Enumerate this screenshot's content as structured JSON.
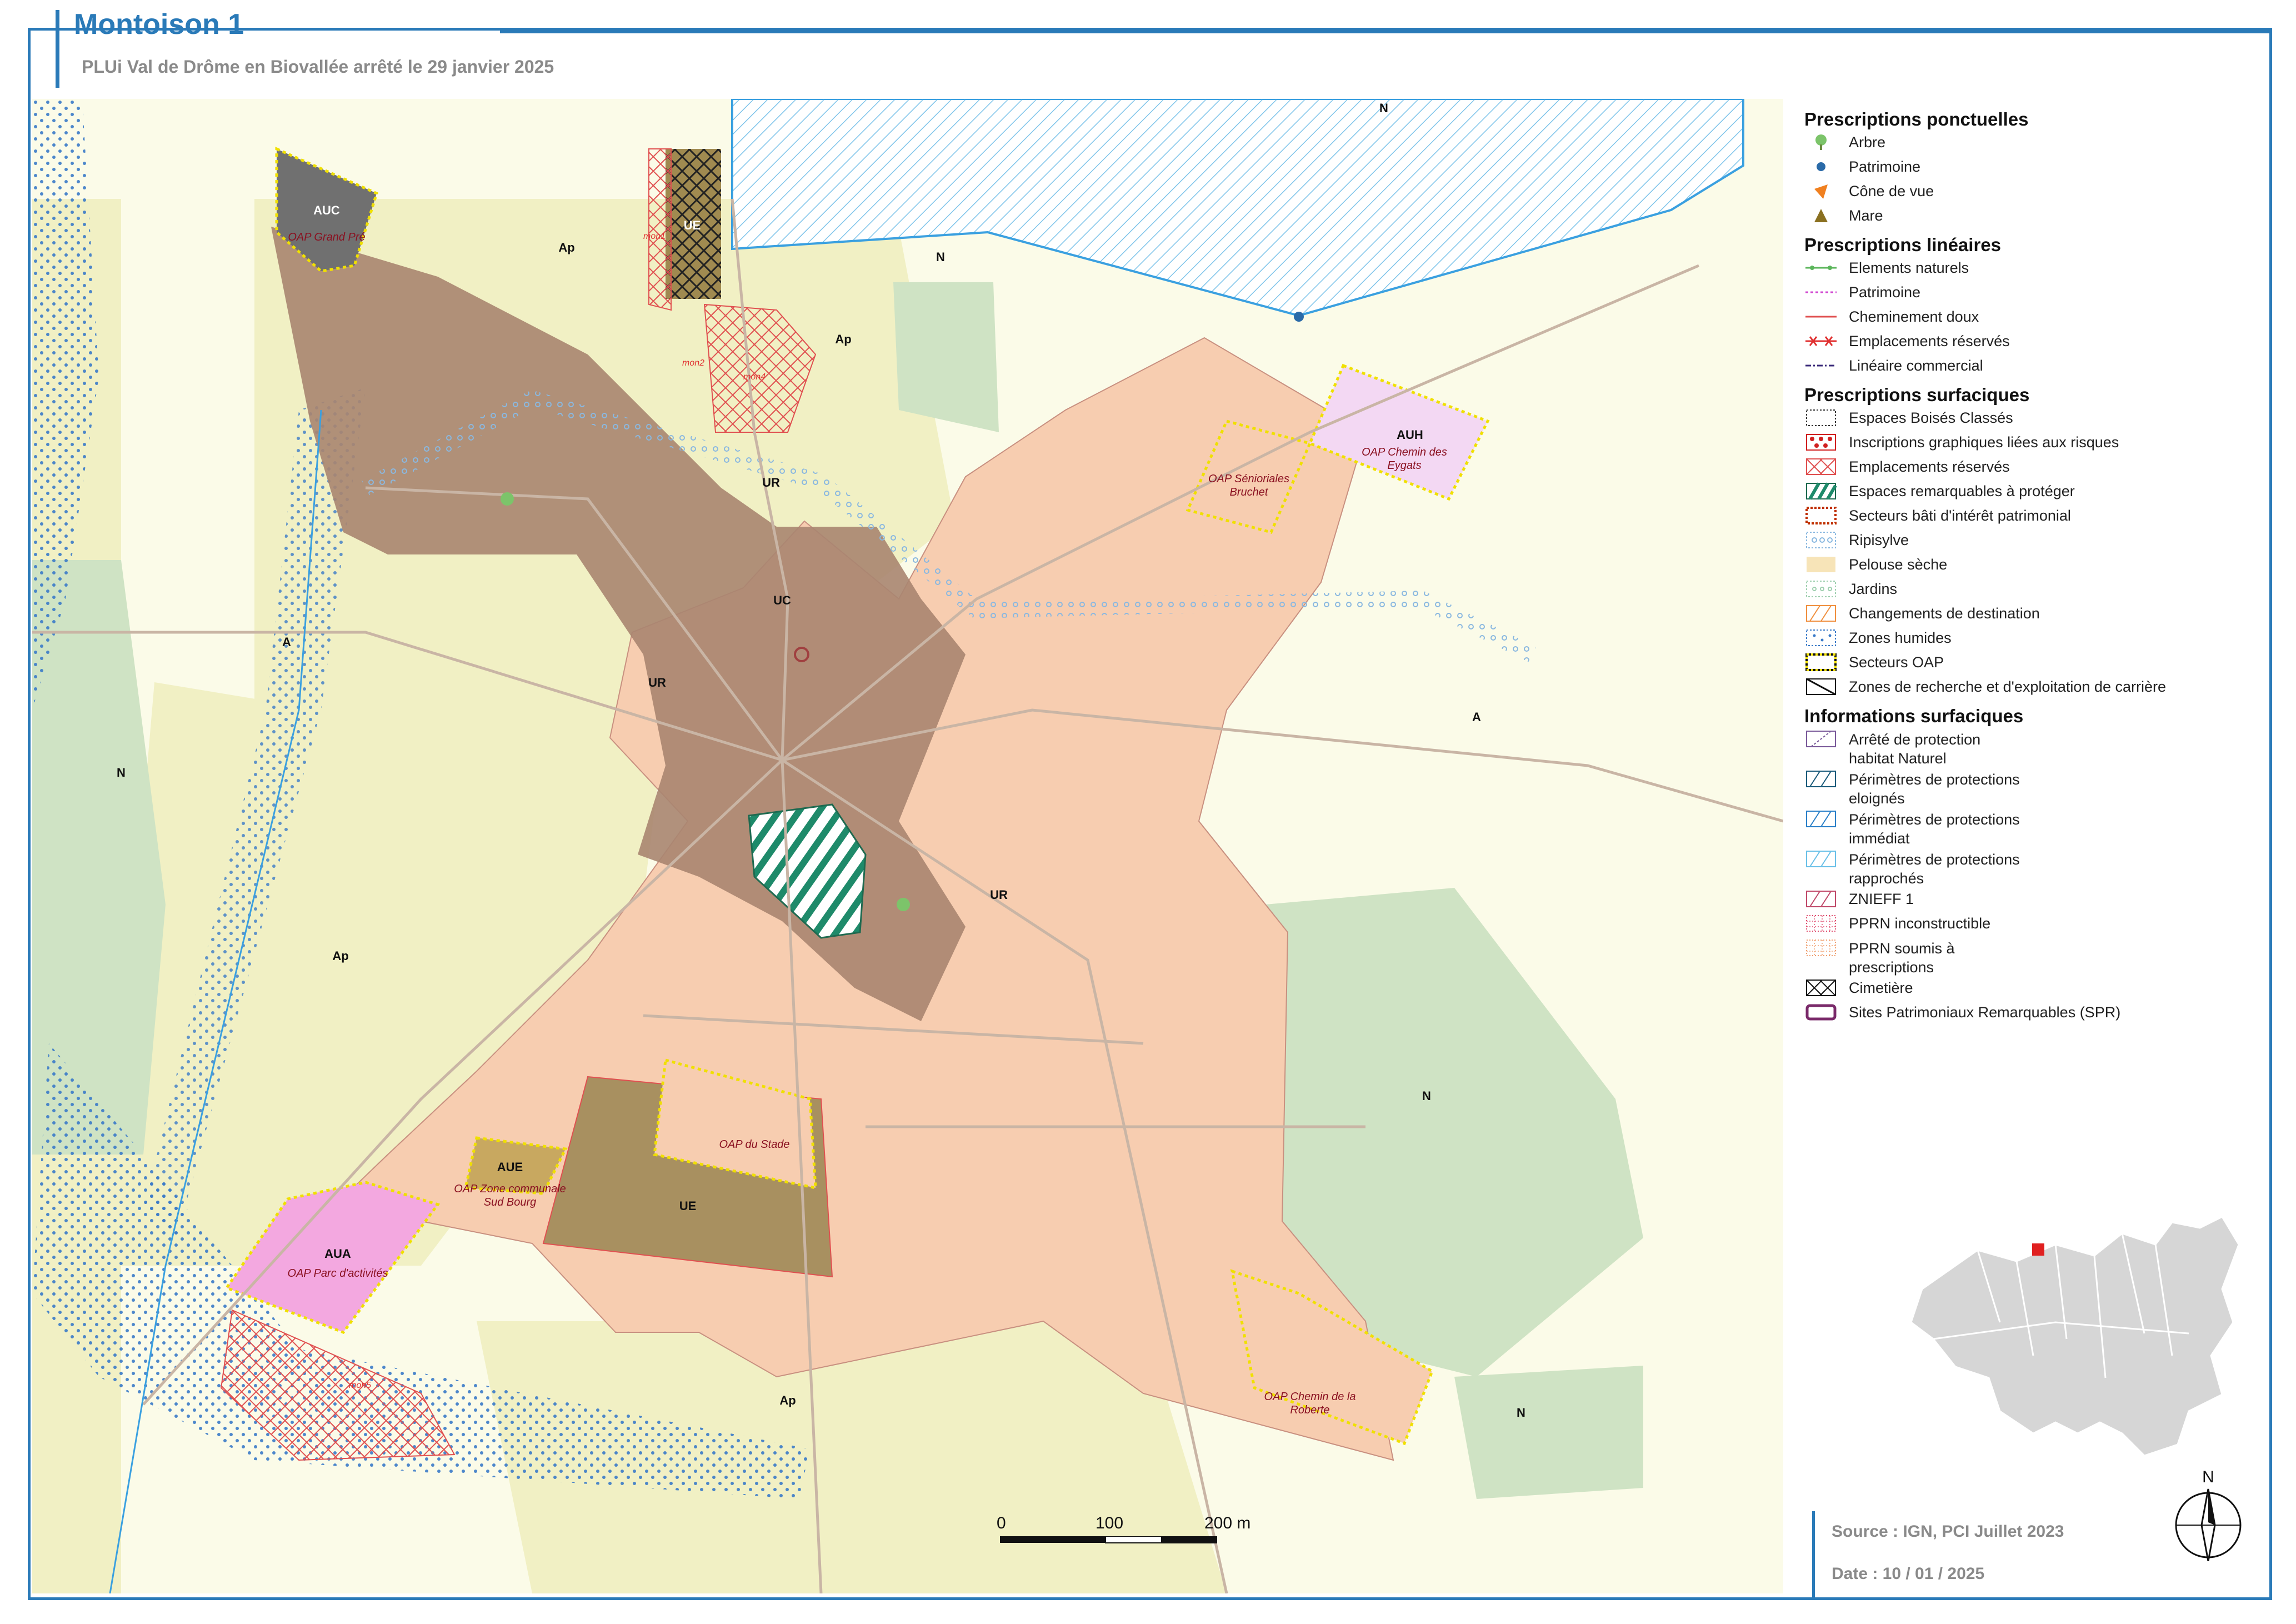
{
  "title": "Montoison 1",
  "subtitle": "PLUi Val de Drôme en Biovallée arrêté le 29 janvier 2025",
  "map": {
    "zone_labels": {
      "auc": "AUC",
      "ue_top": "UE",
      "ap_top": "Ap",
      "ap_mid": "Ap",
      "n_top": "N",
      "n_top_right": "N",
      "ur_1": "UR",
      "uc": "UC",
      "ur_2": "UR",
      "ur_3": "UR",
      "a_left": "A",
      "a_right": "A",
      "n_left": "N",
      "ap_left": "Ap",
      "auh": "AUH",
      "aue": "AUE",
      "ue_bottom": "UE",
      "aua": "AUA",
      "n_right": "N",
      "n_bottom_right": "N",
      "ap_bottom": "Ap"
    },
    "oap_labels": {
      "grand_pre": "OAP Grand Pré",
      "senioriales_1": "OAP Sénioriales",
      "senioriales_2": "Bruchet",
      "eygats_1": "OAP Chemin des",
      "eygats_2": "Eygats",
      "stade": "OAP du Stade",
      "sud_bourg_1": "OAP Zone communale",
      "sud_bourg_2": "Sud Bourg",
      "parc_activites": "OAP Parc d'activités",
      "roberte_1": "OAP Chemin de la",
      "roberte_2": "Roberte"
    },
    "reserved_labels": {
      "er1": "mon1",
      "er2": "mon2",
      "er4": "mon4",
      "er5": "mon5"
    }
  },
  "legend": {
    "ponctuelles_title": "Prescriptions ponctuelles",
    "ponctuelles": [
      {
        "label": "Arbre",
        "icon": "tree-icon"
      },
      {
        "label": "Patrimoine",
        "icon": "dot-icon"
      },
      {
        "label": "Cône de vue",
        "icon": "view-cone-icon"
      },
      {
        "label": "Mare",
        "icon": "triangle-icon"
      }
    ],
    "lineaires_title": "Prescriptions linéaires",
    "lineaires": [
      {
        "label": "Elements naturels",
        "color": "#5bb55b"
      },
      {
        "label": "Patrimoine",
        "color": "#d04ad0"
      },
      {
        "label": "Cheminement doux",
        "color": "#e05050"
      },
      {
        "label": "Emplacements réservés",
        "color": "#e03030"
      },
      {
        "label": "Linéaire commercial",
        "color": "#3a2a7a"
      }
    ],
    "surfaciques_title": "Prescriptions surfaciques",
    "surfaciques": [
      {
        "label": "Espaces Boisés Classés"
      },
      {
        "label": "Inscriptions graphiques liées aux risques"
      },
      {
        "label": "Emplacements réservés"
      },
      {
        "label": "Espaces remarquables à protéger"
      },
      {
        "label": "Secteurs bâti d'intérêt patrimonial"
      },
      {
        "label": "Ripisylve"
      },
      {
        "label": "Pelouse sèche"
      },
      {
        "label": "Jardins"
      },
      {
        "label": "Changements de destination"
      },
      {
        "label": "Zones humides"
      },
      {
        "label": "Secteurs OAP"
      },
      {
        "label": "Zones de recherche et d'exploitation de carrière"
      }
    ],
    "informations_title": "Informations surfaciques",
    "informations": [
      {
        "label": "Arrêté de protection habitat Naturel"
      },
      {
        "label": "Périmètres de protections eloignés"
      },
      {
        "label": "Périmètres de protections immédiat"
      },
      {
        "label": "Périmètres de protections rapprochés"
      },
      {
        "label": "ZNIEFF 1"
      },
      {
        "label": "PPRN inconstructible"
      },
      {
        "label": "PPRN soumis à prescriptions"
      },
      {
        "label": "Cimetière"
      },
      {
        "label": "Sites Patrimoniaux Remarquables (SPR)"
      }
    ]
  },
  "scale": {
    "zero": "0",
    "mid": "100",
    "max": "200 m"
  },
  "north_label": "N",
  "source": "Source : IGN, PCI Juillet 2023",
  "date": "Date : 10 / 01 / 2025",
  "colors": {
    "accent": "#2a7ab8",
    "ur": "#f7cdb0",
    "uc": "#a98570",
    "agri_protected": "#f1f0c4",
    "agri": "#fbfbe8",
    "natural": "#cfe3c4",
    "aua": "#f3a8e0",
    "auh": "#f3d8f3",
    "ue": "#a89060",
    "auc": "#707070"
  }
}
